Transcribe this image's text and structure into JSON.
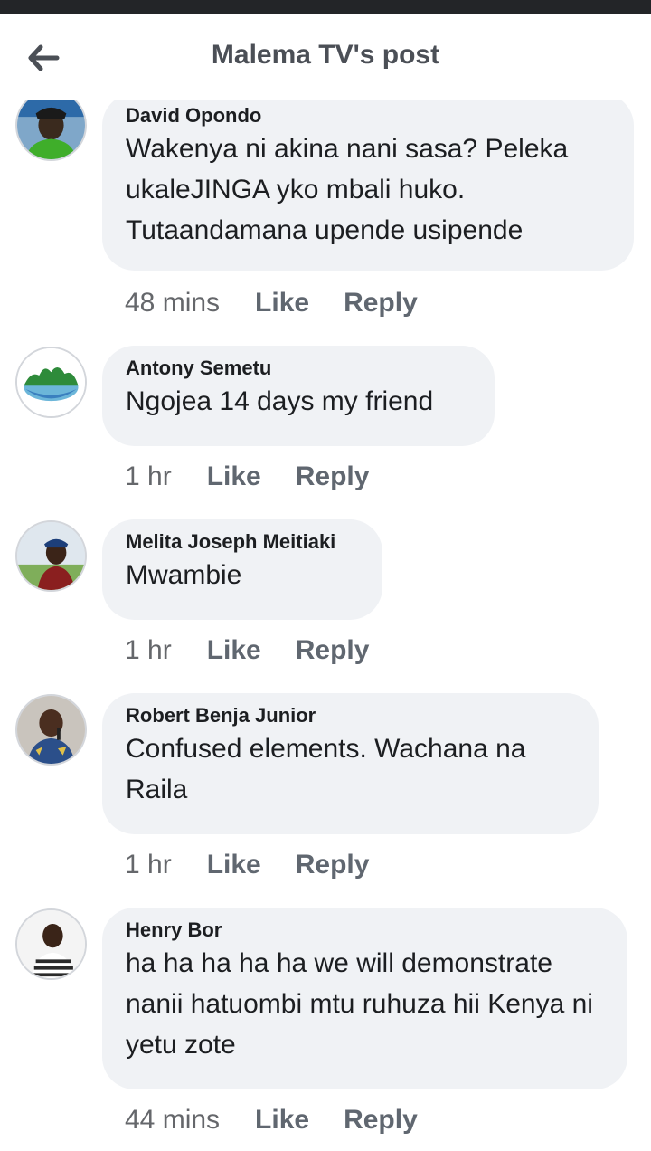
{
  "header": {
    "title": "Malema TV's post",
    "back_icon": "arrow-left-icon"
  },
  "comments": [
    {
      "author": "David Opondo",
      "text": "Wakenya ni akina nani sasa? Peleka ukaleJINGA yko mbali huko. Tutaandamana upende usipende",
      "time": "48 mins",
      "like": "Like",
      "reply": "Reply"
    },
    {
      "author": "Antony Semetu",
      "text": "Ngojea 14 days my friend",
      "time": "1 hr",
      "like": "Like",
      "reply": "Reply"
    },
    {
      "author": "Melita Joseph Meitiaki",
      "text": "Mwambie",
      "time": "1 hr",
      "like": "Like",
      "reply": "Reply"
    },
    {
      "author": "Robert Benja Junior",
      "text": "Confused elements. Wachana na Raila",
      "time": "1 hr",
      "like": "Like",
      "reply": "Reply"
    },
    {
      "author": "Henry Bor",
      "text": "ha ha ha ha ha we will demonstrate nanii hatuombi mtu ruhuza hii Kenya ni yetu zote",
      "time": "44 mins",
      "like": "Like",
      "reply": "Reply"
    }
  ],
  "colors": {
    "bubble": "#f0f2f5",
    "muted_text": "#606770",
    "status_bar": "#232528"
  }
}
